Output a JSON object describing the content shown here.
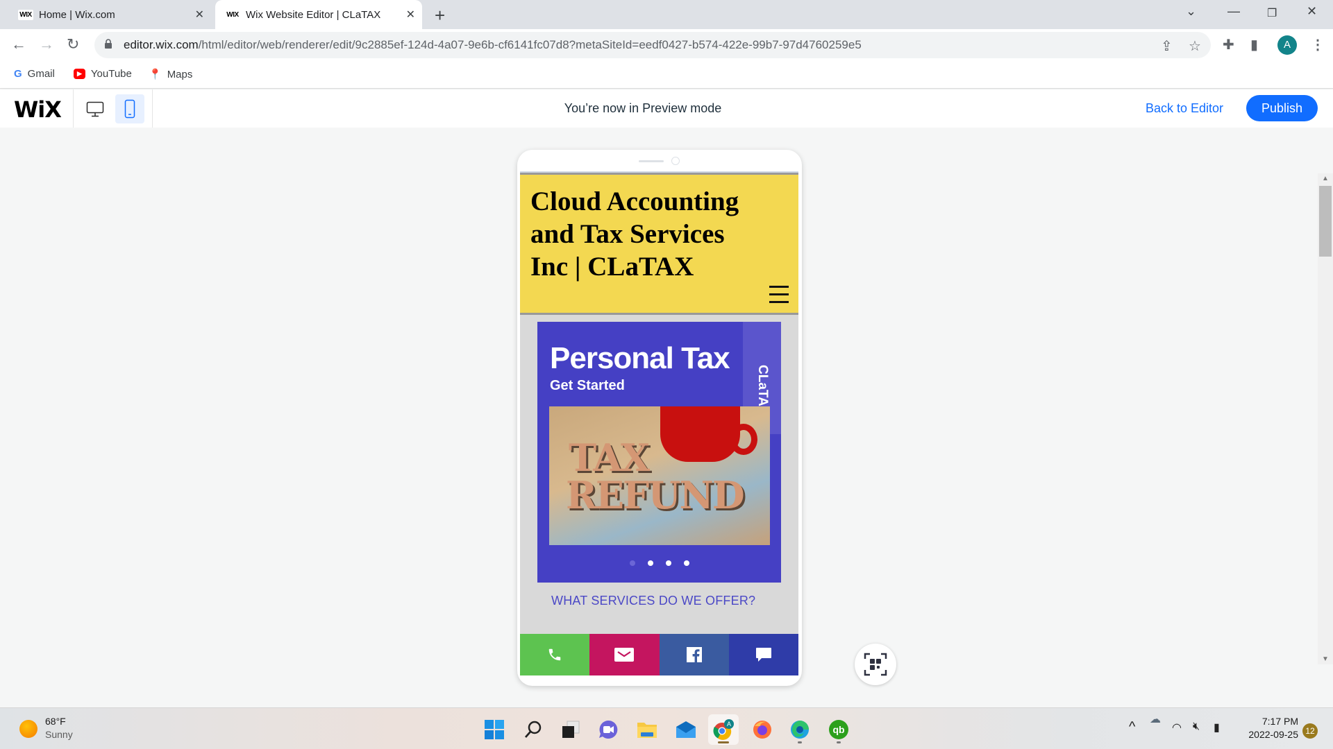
{
  "browser": {
    "tabs": [
      {
        "favicon": "WIX",
        "title": "Home | Wix.com",
        "active": false
      },
      {
        "favicon": "WIX",
        "title": "Wix Website Editor | CLaTAX",
        "active": true
      }
    ],
    "new_tab_icon": "plus-icon",
    "url_host": "editor.wix.com",
    "url_path": "/html/editor/web/renderer/edit/9c2885ef-124d-4a07-9e6b-cf6141fc07d8?metaSiteId=eedf0427-b574-422e-99b7-97d4760259e5",
    "profile_initial": "A",
    "bookmarks": [
      {
        "label": "Gmail",
        "icon": "gmail-icon"
      },
      {
        "label": "YouTube",
        "icon": "youtube-icon"
      },
      {
        "label": "Maps",
        "icon": "maps-icon"
      }
    ]
  },
  "wix_bar": {
    "logo": "WiX",
    "preview_message": "You’re now in Preview mode",
    "back_to_editor": "Back to Editor",
    "publish": "Publish",
    "view_mode": "mobile",
    "accent_color": "#116dff"
  },
  "site": {
    "title": "Cloud Accounting and Tax Services Inc | CLaTAX",
    "header_color": "#f3d851",
    "slider": {
      "title": "Personal Tax",
      "subtitle": "Get Started",
      "brand_tab": "CLaTAX",
      "image_alt": "TAX REFUND letterpress blocks beside red coffee mug",
      "image_words": [
        "TAX",
        "REFUND"
      ],
      "slide_count": 4,
      "active_slide": 1,
      "bg_color": "#4540c4"
    },
    "services_link": "WHAT SERVICES DO WE OFFER?",
    "action_bar": [
      {
        "name": "phone",
        "color": "#5dc350"
      },
      {
        "name": "email",
        "color": "#c4155f"
      },
      {
        "name": "facebook",
        "color": "#3a5ba0"
      },
      {
        "name": "chat",
        "color": "#2f3ca8"
      }
    ]
  },
  "taskbar": {
    "weather_temp": "68°F",
    "weather_condition": "Sunny",
    "apps": [
      "start",
      "search",
      "task-view",
      "teams-chat",
      "file-explorer",
      "mail",
      "chrome",
      "firefox",
      "edge",
      "quickbooks"
    ],
    "time": "7:17 PM",
    "date": "2022-09-25",
    "notification_count": "12"
  }
}
